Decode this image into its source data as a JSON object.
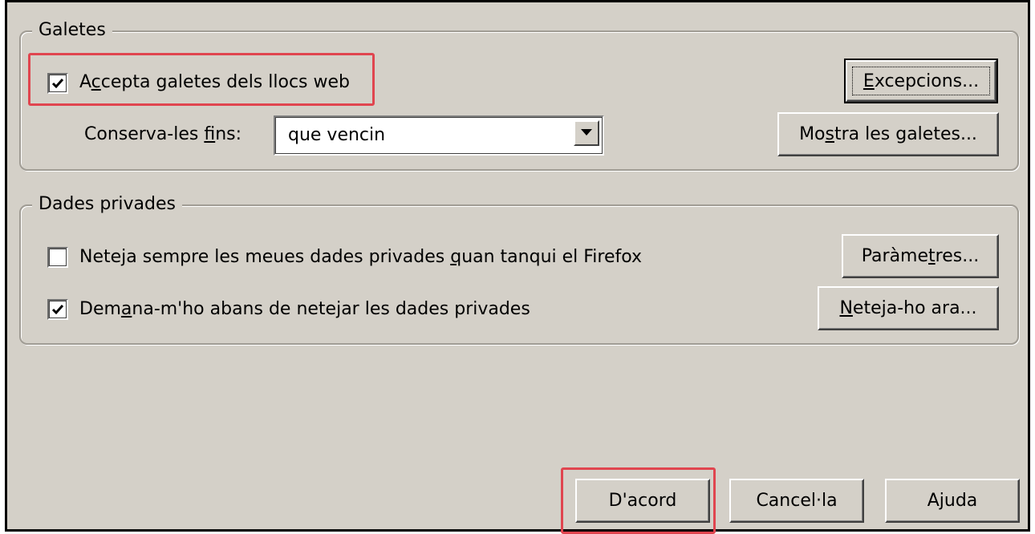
{
  "cookies": {
    "legend": "Galetes",
    "accept": {
      "label_pre": "A",
      "label_mn": "c",
      "label_post": "cepta galetes dels llocs web",
      "checked": true
    },
    "keep_until": {
      "label_pre": "Conserva-les ",
      "label_mn": "f",
      "label_post": "ins:",
      "value": "que vencin"
    },
    "exceptions_button": {
      "label_pre": "",
      "label_mn": "E",
      "label_post": "xcepcions..."
    },
    "show_cookies_button": {
      "label_pre": "Mo",
      "label_mn": "s",
      "label_post": "tra les galetes..."
    }
  },
  "private_data": {
    "legend": "Dades privades",
    "always_clear": {
      "label_pre": "Neteja sempre les meues dades privades ",
      "label_mn": "q",
      "label_post": "uan tanqui el Firefox",
      "checked": false
    },
    "ask_before": {
      "label_pre": "Dem",
      "label_mn": "a",
      "label_post": "na-m'ho abans de netejar les dades privades",
      "checked": true
    },
    "settings_button": {
      "label_pre": "Paràme",
      "label_mn": "t",
      "label_post": "res..."
    },
    "clear_now_button": {
      "label_pre": "",
      "label_mn": "N",
      "label_post": "eteja-ho ara..."
    }
  },
  "footer": {
    "ok_label": "D'acord",
    "cancel_label": "Cancel·la",
    "help_label": "Ajuda"
  },
  "colors": {
    "dialog_bg": "#d4d0c8",
    "highlight": "#e0454f"
  },
  "icons": {
    "checkmark": "checkmark-icon",
    "dropdown": "dropdown-arrow-icon"
  }
}
